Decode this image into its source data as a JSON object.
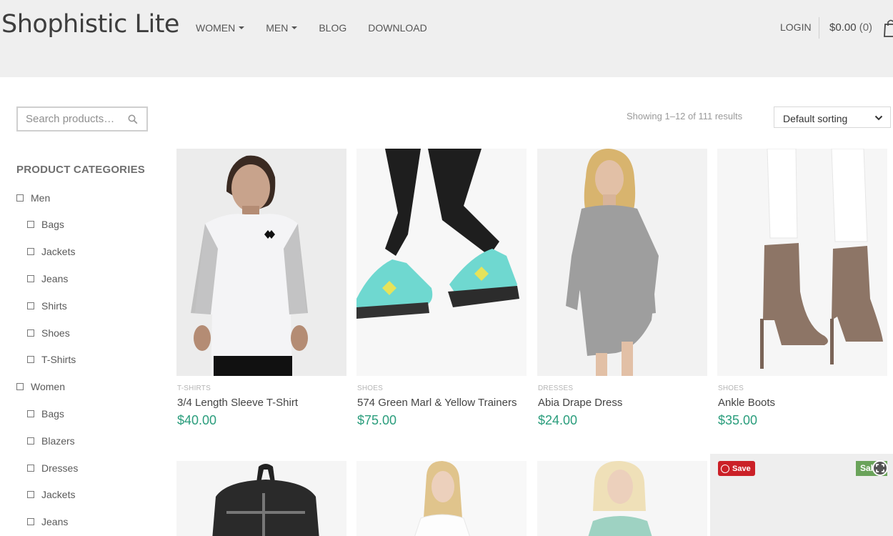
{
  "header": {
    "logo": "Shophistic Lite",
    "nav": [
      {
        "label": "WOMEN",
        "has_dropdown": true
      },
      {
        "label": "MEN",
        "has_dropdown": true
      },
      {
        "label": "BLOG",
        "has_dropdown": false
      },
      {
        "label": "DOWNLOAD",
        "has_dropdown": false
      }
    ],
    "login": "LOGIN",
    "cart_total": "$0.00",
    "cart_count": "(0)"
  },
  "sidebar": {
    "search_placeholder": "Search products…",
    "categories_title": "PRODUCT CATEGORIES",
    "categories": [
      {
        "label": "Men",
        "level": 0
      },
      {
        "label": "Bags",
        "level": 1
      },
      {
        "label": "Jackets",
        "level": 1
      },
      {
        "label": "Jeans",
        "level": 1
      },
      {
        "label": "Shirts",
        "level": 1
      },
      {
        "label": "Shoes",
        "level": 1
      },
      {
        "label": "T-Shirts",
        "level": 1
      },
      {
        "label": "Women",
        "level": 0
      },
      {
        "label": "Bags",
        "level": 1
      },
      {
        "label": "Blazers",
        "level": 1
      },
      {
        "label": "Dresses",
        "level": 1
      },
      {
        "label": "Jackets",
        "level": 1
      },
      {
        "label": "Jeans",
        "level": 1
      }
    ]
  },
  "toolbar": {
    "result_count": "Showing 1–12 of 111 results",
    "sort_label": "Default sorting"
  },
  "products": [
    {
      "category": "T-SHIRTS",
      "name": "3/4 Length Sleeve T-Shirt",
      "price": "$40.00"
    },
    {
      "category": "SHOES",
      "name": "574 Green Marl & Yellow Trainers",
      "price": "$75.00"
    },
    {
      "category": "DRESSES",
      "name": "Abia Drape Dress",
      "price": "$24.00"
    },
    {
      "category": "SHOES",
      "name": "Ankle Boots",
      "price": "$35.00"
    }
  ],
  "overlays": {
    "pin_label": "Save",
    "sale_label": "Sale!"
  },
  "colors": {
    "price": "#2a9d7c",
    "header_bg": "#efefef",
    "pinterest": "#cb2027",
    "sale_badge": "#6aa35a"
  }
}
